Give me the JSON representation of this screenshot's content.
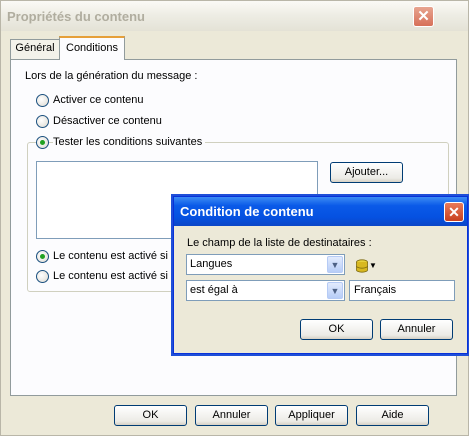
{
  "main": {
    "title": "Propriétés du contenu",
    "tabs": [
      "Général",
      "Conditions"
    ],
    "prompt": "Lors de la génération du message :",
    "options": [
      "Activer ce contenu",
      "Désactiver ce contenu",
      "Tester les conditions suivantes"
    ],
    "add_button": "Ajouter...",
    "activation_options": [
      "Le contenu est activé si to",
      "Le contenu est activé si a"
    ],
    "buttons": {
      "ok": "OK",
      "cancel": "Annuler",
      "apply": "Appliquer",
      "help": "Aide"
    },
    "close_glyph": "✕"
  },
  "dialog": {
    "title": "Condition de contenu",
    "field_label": "Le champ de la liste de destinataires :",
    "field_value": "Langues",
    "operator_value": "est égal à",
    "compare_value": "Français",
    "ok": "OK",
    "cancel": "Annuler",
    "close_glyph": "✕"
  },
  "colors": {
    "title_active": "#0551e1",
    "title_inactive": "#eeede5",
    "radio_dot": "#21a121"
  },
  "icons": {
    "close": "close-icon",
    "database": "database-icon",
    "dropdown": "chevron-down-icon"
  }
}
